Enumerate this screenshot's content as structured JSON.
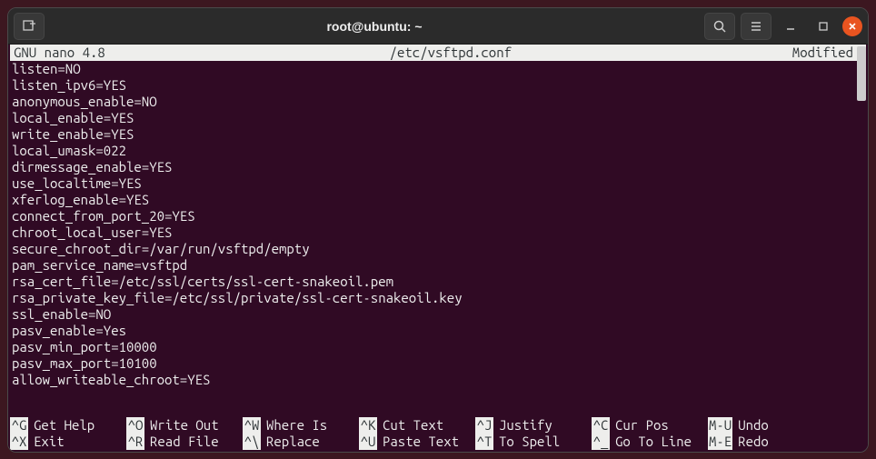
{
  "window": {
    "title": "root@ubuntu: ~"
  },
  "nano": {
    "app": "  GNU nano 4.8",
    "file": "/etc/vsftpd.conf",
    "status": "Modified"
  },
  "content": [
    "listen=NO",
    "listen_ipv6=YES",
    "anonymous_enable=NO",
    "local_enable=YES",
    "write_enable=YES",
    "local_umask=022",
    "dirmessage_enable=YES",
    "use_localtime=YES",
    "xferlog_enable=YES",
    "connect_from_port_20=YES",
    "chroot_local_user=YES",
    "secure_chroot_dir=/var/run/vsftpd/empty",
    "pam_service_name=vsftpd",
    "rsa_cert_file=/etc/ssl/certs/ssl-cert-snakeoil.pem",
    "rsa_private_key_file=/etc/ssl/private/ssl-cert-snakeoil.key",
    "ssl_enable=NO",
    "pasv_enable=Yes",
    "pasv_min_port=10000",
    "pasv_max_port=10100",
    "allow_writeable_chroot=YES"
  ],
  "shortcuts": {
    "row1": [
      {
        "key": "^G",
        "label": "Get Help"
      },
      {
        "key": "^O",
        "label": "Write Out"
      },
      {
        "key": "^W",
        "label": "Where Is"
      },
      {
        "key": "^K",
        "label": "Cut Text"
      },
      {
        "key": "^J",
        "label": "Justify"
      },
      {
        "key": "^C",
        "label": "Cur Pos"
      },
      {
        "key": "M-U",
        "label": "Undo"
      }
    ],
    "row2": [
      {
        "key": "^X",
        "label": "Exit"
      },
      {
        "key": "^R",
        "label": "Read File"
      },
      {
        "key": "^\\",
        "label": "Replace"
      },
      {
        "key": "^U",
        "label": "Paste Text"
      },
      {
        "key": "^T",
        "label": "To Spell"
      },
      {
        "key": "^_",
        "label": "Go To Line"
      },
      {
        "key": "M-E",
        "label": "Redo"
      }
    ]
  }
}
